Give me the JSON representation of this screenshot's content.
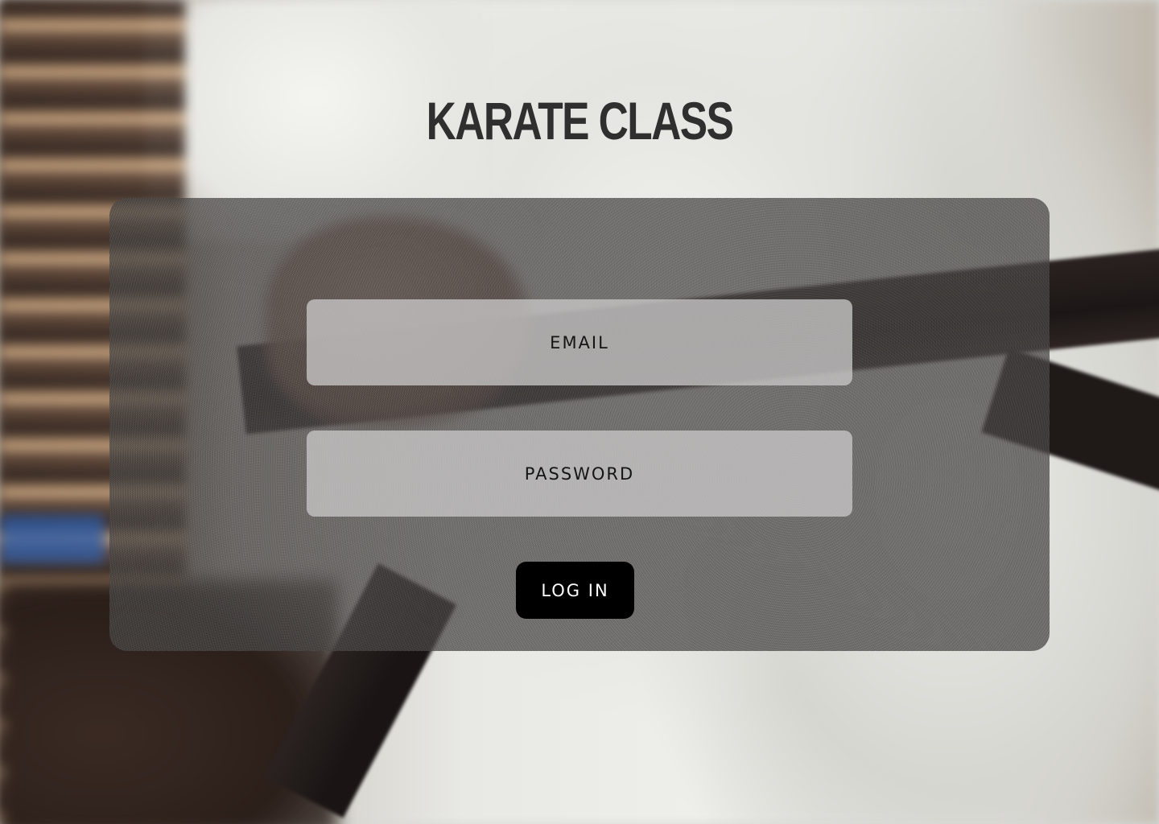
{
  "header": {
    "title": "KARATE CLASS"
  },
  "login_form": {
    "email": {
      "placeholder": "EMAIL",
      "value": ""
    },
    "password": {
      "placeholder": "PASSWORD",
      "value": ""
    },
    "submit_label": "LOG IN"
  },
  "colors": {
    "title_text": "#2f2f2f",
    "panel_background": "#464442",
    "field_background": "#c8c6c6",
    "button_background": "#000000",
    "button_text": "#ffffff"
  }
}
